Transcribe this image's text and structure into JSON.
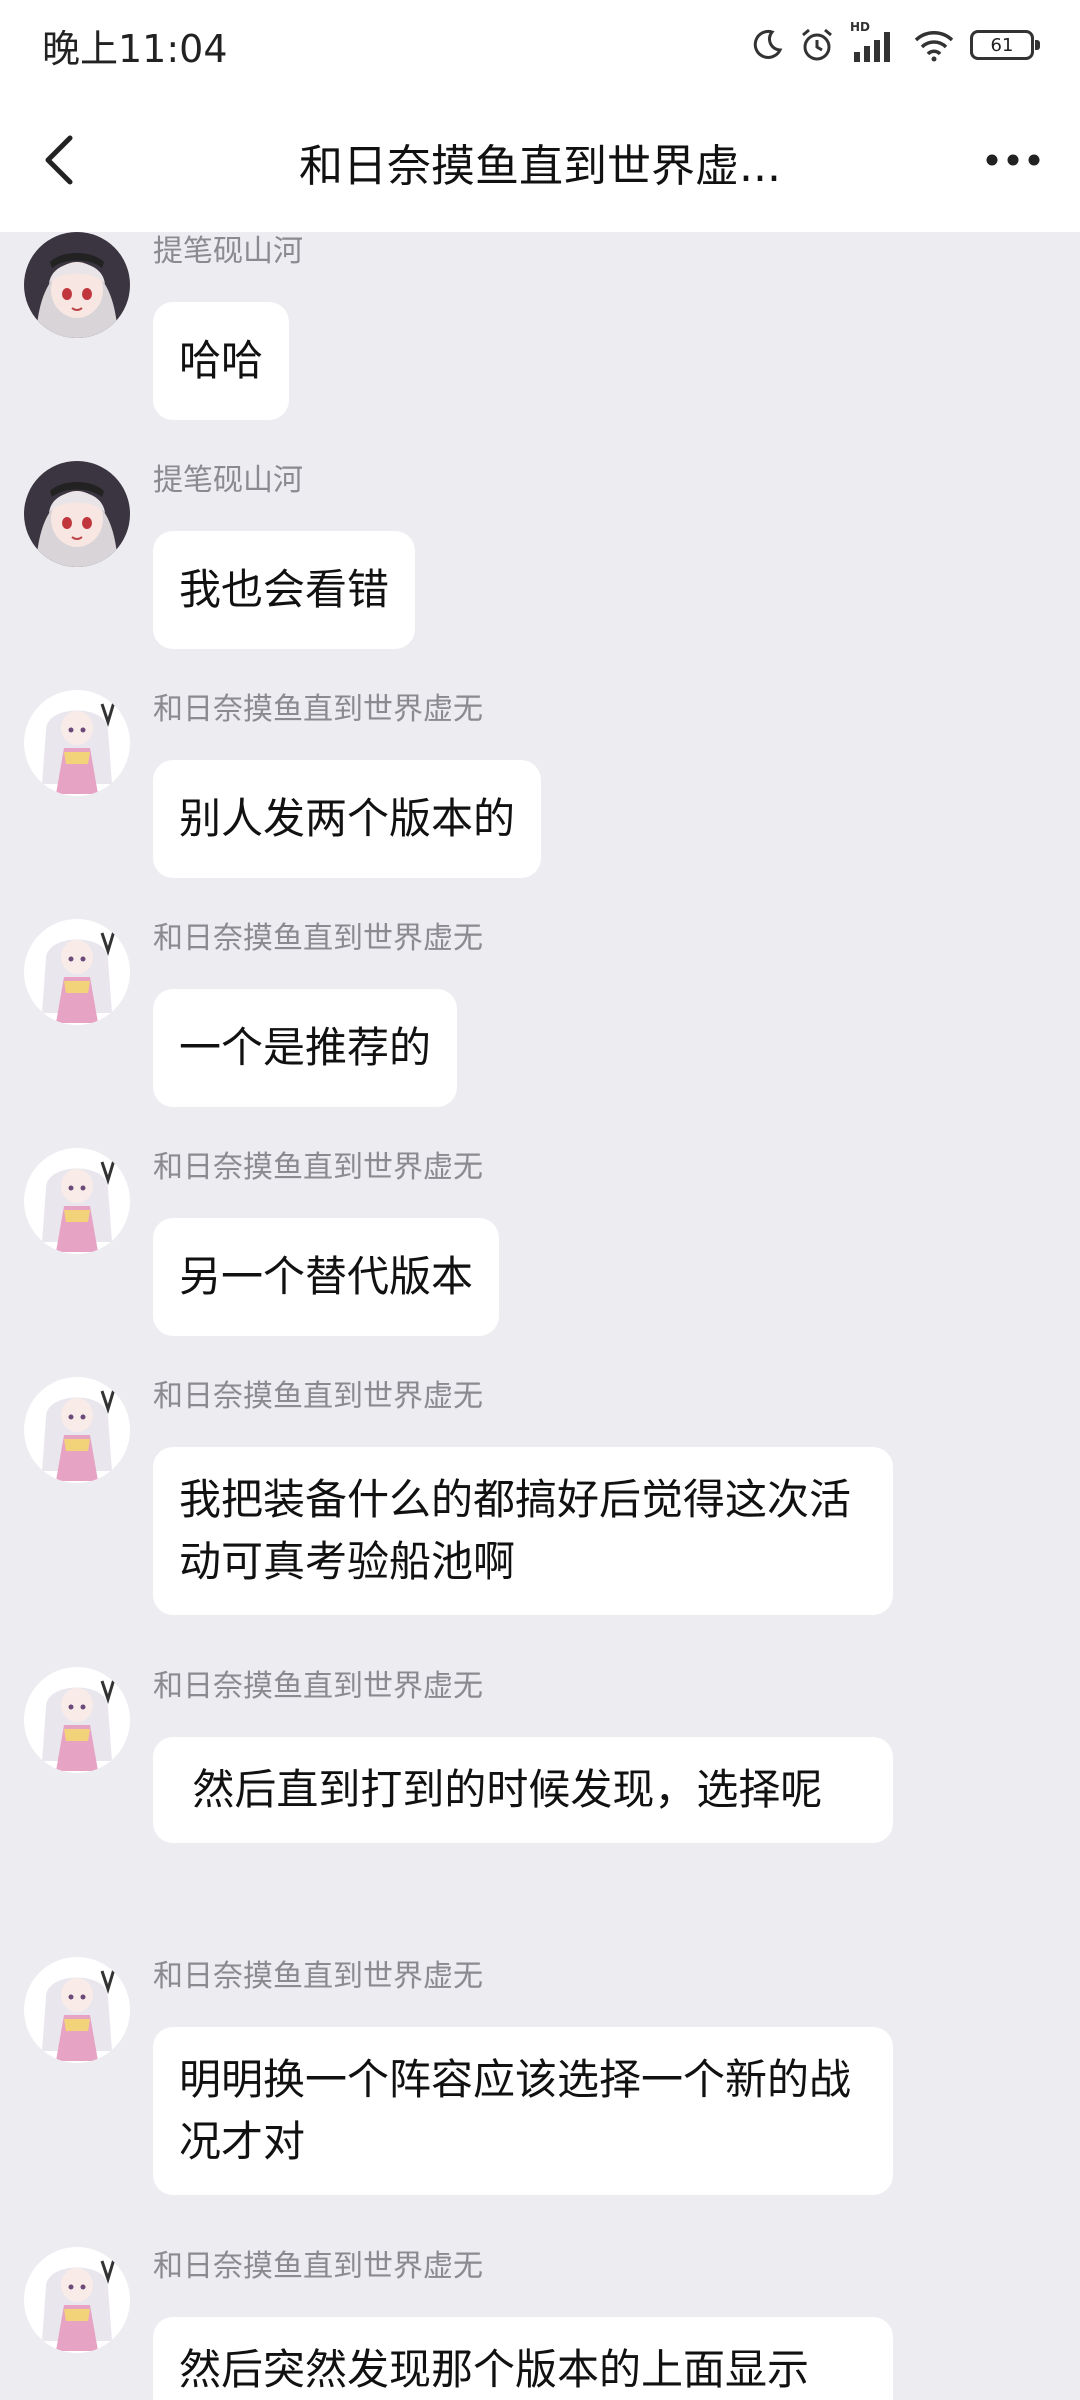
{
  "status_bar": {
    "time": "晚上11:04",
    "hd_label": "HD",
    "battery": "61",
    "icons": [
      "moon-icon",
      "alarm-icon",
      "signal-icon",
      "wifi-icon",
      "battery-icon"
    ]
  },
  "header": {
    "title": "和日奈摸鱼直到世界虚...",
    "back_icon": "chevron-left-icon",
    "more_icon": "more-dots-icon"
  },
  "messages": [
    {
      "sender": "提笔砚山河",
      "avatar": "avatar-dark-hair",
      "text": "哈哈"
    },
    {
      "sender": "提笔砚山河",
      "avatar": "avatar-dark-hair",
      "text": "我也会看错"
    },
    {
      "sender": "和日奈摸鱼直到世界虚无",
      "avatar": "avatar-pink-dress",
      "text": "别人发两个版本的"
    },
    {
      "sender": "和日奈摸鱼直到世界虚无",
      "avatar": "avatar-pink-dress",
      "text": "一个是推荐的"
    },
    {
      "sender": "和日奈摸鱼直到世界虚无",
      "avatar": "avatar-pink-dress",
      "text": "另一个替代版本"
    },
    {
      "sender": "和日奈摸鱼直到世界虚无",
      "avatar": "avatar-pink-dress",
      "text": "我把装备什么的都搞好后觉得这次活动可真考验船池啊"
    },
    {
      "sender": "和日奈摸鱼直到世界虚无",
      "avatar": "avatar-pink-dress",
      "text": " 然后直到打到的时候发现，选择呢"
    },
    {
      "sender": "和日奈摸鱼直到世界虚无",
      "avatar": "avatar-pink-dress",
      "text": "明明换一个阵容应该选择一个新的战况才对"
    },
    {
      "sender": "和日奈摸鱼直到世界虚无",
      "avatar": "avatar-pink-dress",
      "text": "然后突然发现那个版本的上面显示"
    }
  ]
}
